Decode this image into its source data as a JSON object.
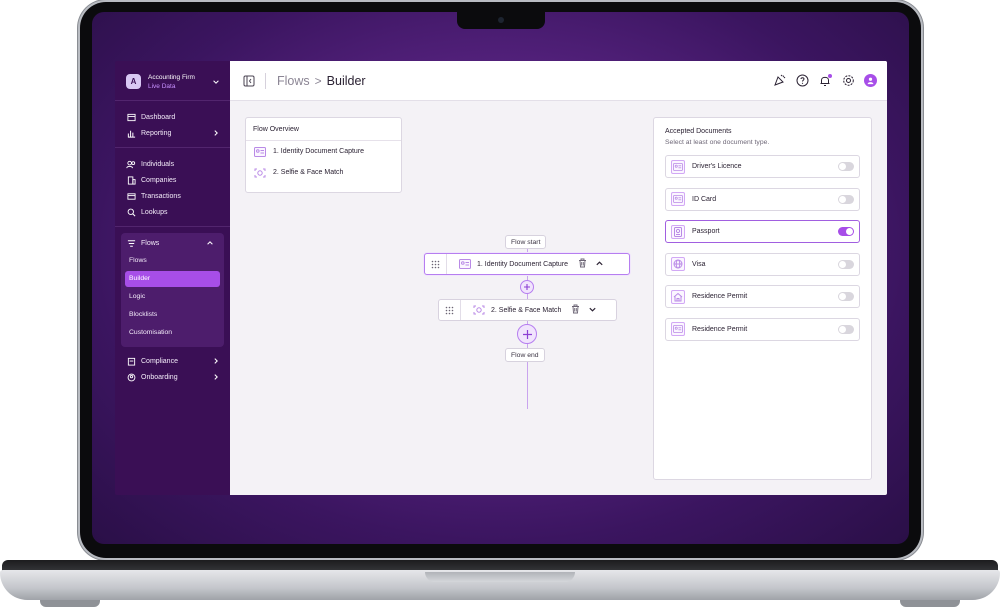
{
  "org": {
    "initial": "A",
    "name": "Accounting Firm",
    "mode": "Live Data"
  },
  "sidebar": {
    "group1": [
      {
        "label": "Dashboard",
        "icon": "dashboard-icon"
      },
      {
        "label": "Reporting",
        "icon": "bar-chart-icon",
        "chevron": true
      }
    ],
    "group2": [
      {
        "label": "Individuals",
        "icon": "users-icon"
      },
      {
        "label": "Companies",
        "icon": "building-icon"
      },
      {
        "label": "Transactions",
        "icon": "transactions-icon"
      },
      {
        "label": "Lookups",
        "icon": "search-icon"
      }
    ],
    "flows": {
      "label": "Flows",
      "items": [
        "Flows",
        "Builder",
        "Logic",
        "Blocklists",
        "Customisation"
      ],
      "active": "Builder"
    },
    "group3": [
      {
        "label": "Compliance",
        "icon": "clipboard-icon"
      },
      {
        "label": "Onboarding",
        "icon": "onboarding-icon"
      }
    ]
  },
  "breadcrumb": {
    "root": "Flows",
    "separator": ">",
    "current": "Builder"
  },
  "overview": {
    "title": "Flow Overview",
    "items": [
      "1. Identity Document Capture",
      "2. Selfie & Face Match"
    ]
  },
  "canvas": {
    "start_label": "Flow start",
    "end_label": "Flow end",
    "steps": [
      "1. Identity Document Capture",
      "2. Selfie & Face Match"
    ]
  },
  "documents": {
    "title": "Accepted Documents",
    "subtitle": "Select at least one document type.",
    "items": [
      {
        "label": "Driver's Licence",
        "icon": "id-card-icon",
        "enabled": false
      },
      {
        "label": "ID Card",
        "icon": "id-card-icon",
        "enabled": false
      },
      {
        "label": "Passport",
        "icon": "passport-icon",
        "enabled": true
      },
      {
        "label": "Visa",
        "icon": "globe-icon",
        "enabled": false
      },
      {
        "label": "Residence Permit",
        "icon": "house-icon",
        "enabled": false
      },
      {
        "label": "Residence Permit",
        "icon": "id-card-icon",
        "enabled": false
      }
    ]
  },
  "colors": {
    "accent": "#a74ee8",
    "sidebar": "#3a0f55",
    "sidebar_sub": "#4d1d6c"
  }
}
